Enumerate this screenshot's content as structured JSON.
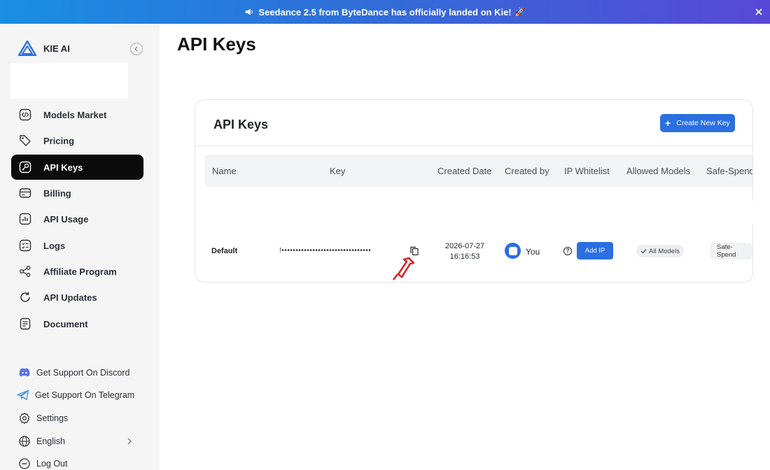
{
  "banner": {
    "text": "Seedance 2.5 from ByteDance has officially landed on Kie!",
    "rocket": "🚀",
    "gradient": [
      "#1a8fe3",
      "#5848d6"
    ]
  },
  "brand": {
    "name": "KIE AI"
  },
  "sidebar": {
    "items": [
      {
        "label": "Models Market",
        "icon": "code-icon"
      },
      {
        "label": "Pricing",
        "icon": "tag-icon"
      },
      {
        "label": "API Keys",
        "icon": "key-icon",
        "active": true
      },
      {
        "label": "Billing",
        "icon": "card-icon"
      },
      {
        "label": "API Usage",
        "icon": "chart-icon"
      },
      {
        "label": "Logs",
        "icon": "logs-icon"
      },
      {
        "label": "Affiliate Program",
        "icon": "share-icon"
      },
      {
        "label": "API Updates",
        "icon": "refresh-icon"
      },
      {
        "label": "Document",
        "icon": "document-icon"
      }
    ],
    "bottom": {
      "discord": "Get Support On Discord",
      "telegram": "Get Support On Telegram",
      "settings": "Settings",
      "language": "English",
      "logout": "Log Out"
    }
  },
  "page": {
    "title": "API Keys"
  },
  "card": {
    "title": "API Keys",
    "create_button": "Create New Key",
    "columns": [
      "Name",
      "Key",
      "Created Date",
      "Created by",
      "IP Whitelist",
      "Allowed Models",
      "Safe-Spend"
    ],
    "row": {
      "name": "Default",
      "key": "!••••••••••••••••••••••••••••••••",
      "date": "2026-07-27",
      "time": "16:16:53",
      "created_by": "You",
      "add_ip": "Add IP",
      "models": "All Models",
      "safe_spend": "Safe-Spend"
    }
  },
  "colors": {
    "accent": "#2b6fe0",
    "active_nav": "#0b0b0c",
    "annotation": "#d9252a"
  }
}
